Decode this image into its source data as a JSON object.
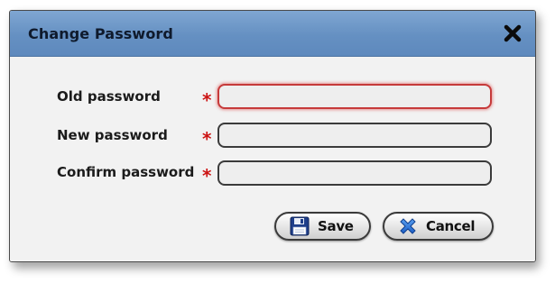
{
  "dialog": {
    "title": "Change Password",
    "close_icon": "close-icon"
  },
  "form": {
    "required_marker": "*",
    "fields": [
      {
        "label": "Old password",
        "value": "",
        "focused": true
      },
      {
        "label": "New password",
        "value": ""
      },
      {
        "label": "Confirm password",
        "value": ""
      }
    ]
  },
  "buttons": {
    "save_label": "Save",
    "save_icon": "floppy-disk-icon",
    "cancel_label": "Cancel",
    "cancel_icon": "cancel-x-icon"
  },
  "colors": {
    "titlebar": "#6590c2",
    "required": "#cc1414",
    "focus_border": "#c63a3a"
  }
}
